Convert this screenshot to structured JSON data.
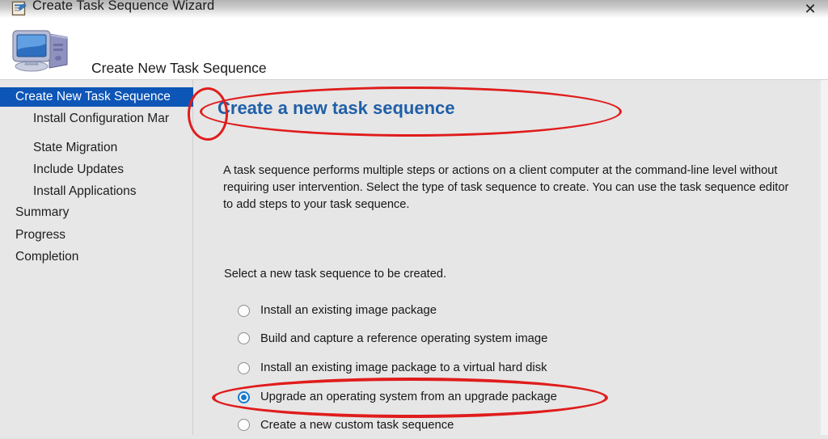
{
  "window": {
    "title": "Create Task Sequence Wizard",
    "title_icon": "task-sequence-document-icon",
    "close_label": "✕"
  },
  "header": {
    "title": "Create New Task Sequence",
    "icon": "computer-monitor-icon"
  },
  "sidebar": {
    "items": [
      {
        "label": "Create New Task Sequence",
        "level": 0,
        "selected": true
      },
      {
        "label": "Install Configuration Mar",
        "level": 1,
        "selected": false
      },
      {
        "label": "State Migration",
        "level": 1,
        "selected": false
      },
      {
        "label": "Include Updates",
        "level": 1,
        "selected": false
      },
      {
        "label": "Install Applications",
        "level": 1,
        "selected": false
      },
      {
        "label": "Summary",
        "level": 0,
        "selected": false
      },
      {
        "label": "Progress",
        "level": 0,
        "selected": false
      },
      {
        "label": "Completion",
        "level": 0,
        "selected": false
      }
    ]
  },
  "main": {
    "heading": "Create a new task sequence",
    "paragraph": "A task sequence performs multiple steps or actions on a client computer at the command-line level without requiring user intervention. Select the type of task sequence to create. You can use the task sequence editor to add steps to your task sequence.",
    "select_prompt": "Select a new task sequence to be created.",
    "options": [
      {
        "label": "Install an existing image package",
        "checked": false
      },
      {
        "label": "Build and capture a reference operating system image",
        "checked": false
      },
      {
        "label": "Install an existing image package to a virtual hard disk",
        "checked": false
      },
      {
        "label": "Upgrade an operating system from an upgrade package",
        "checked": true
      },
      {
        "label": "Create a new custom task sequence",
        "checked": false
      }
    ]
  },
  "annotations": {
    "color": "#e01c1c",
    "marks": [
      {
        "name": "heading-circle",
        "target": "Create a new task sequence"
      },
      {
        "name": "sidebar-circle",
        "target": "Create New Task Sequence"
      },
      {
        "name": "option-circle",
        "target": "Upgrade an operating system from an upgrade package"
      }
    ]
  },
  "colors": {
    "sidebar_selection": "#0d55b6",
    "heading_blue": "#1f5fa8",
    "radio_accent": "#1679cf",
    "background": "#e6e6e6"
  }
}
